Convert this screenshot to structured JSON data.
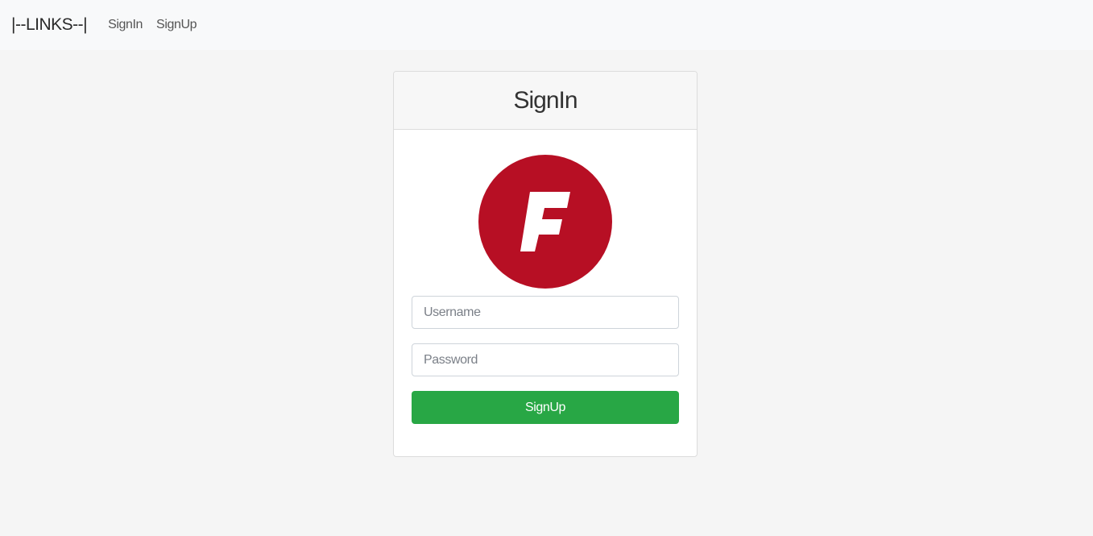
{
  "navbar": {
    "brand": "|--LINKS--|",
    "links": [
      "SignIn",
      "SignUp"
    ]
  },
  "card": {
    "title": "SignIn",
    "logo": {
      "icon": "letter-f-logo",
      "color": "#b70f24"
    },
    "form": {
      "username_placeholder": "Username",
      "password_placeholder": "Password",
      "submit_label": "SignUp",
      "submit_color": "#28a745"
    }
  }
}
